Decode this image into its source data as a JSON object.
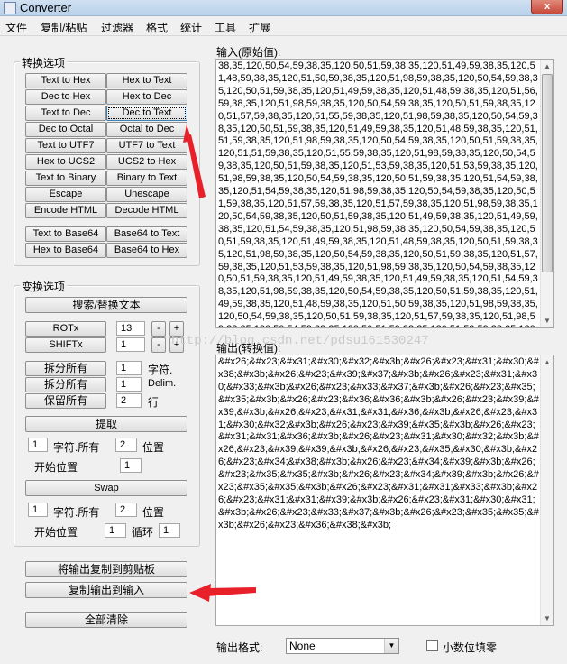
{
  "window": {
    "title": "Converter",
    "close_glyph": "x"
  },
  "menu": [
    "文件",
    "复制/粘贴",
    "过滤器",
    "格式",
    "统计",
    "工具",
    "扩展"
  ],
  "convert_group": {
    "legend": "转换选项",
    "buttons": [
      [
        "Text to Hex",
        "Hex to Text"
      ],
      [
        "Dec to Hex",
        "Hex to Dec"
      ],
      [
        "Text to Dec",
        "Dec to Text"
      ],
      [
        "Dec to Octal",
        "Octal to Dec"
      ],
      [
        "Text to UTF7",
        "UTF7 to Text"
      ],
      [
        "Hex to UCS2",
        "UCS2 to Hex"
      ],
      [
        "Text to Binary",
        "Binary to Text"
      ],
      [
        "Escape",
        "Unescape"
      ],
      [
        "Encode HTML",
        "Decode HTML"
      ],
      [
        "Text to Base64",
        "Base64 to Text"
      ],
      [
        "Hex to Base64",
        "Base64 to Hex"
      ]
    ]
  },
  "transform_group": {
    "legend": "变换选项",
    "search_replace": "搜索/替换文本",
    "rotx": {
      "label": "ROTx",
      "value": "13",
      "minus": "-",
      "plus": "+"
    },
    "shiftx": {
      "label": "SHIFTx",
      "value": "1",
      "minus": "-",
      "plus": "+"
    },
    "split_all_1": {
      "label": "拆分所有",
      "value": "1",
      "suffix": "字符."
    },
    "split_all_2": {
      "label": "拆分所有",
      "value": "1",
      "suffix": "Delim."
    },
    "keep_all": {
      "label": "保留所有",
      "value": "2",
      "suffix": "行"
    },
    "extract": {
      "label": "提取",
      "count": "1",
      "count_label": "字符.所有",
      "pos": "2",
      "pos_label": "位置",
      "start_label": "开始位置",
      "start": "1"
    },
    "swap": {
      "label": "Swap",
      "count": "1",
      "count_label": "字符.所有",
      "pos": "2",
      "pos_label": "位置",
      "start_label": "开始位置",
      "start": "1",
      "loop_label": "循环",
      "loop": "1"
    }
  },
  "actions": {
    "copy_clipboard": "将输出复制到剪贴板",
    "copy_to_input": "复制输出到输入",
    "clear_all": "全部清除"
  },
  "input": {
    "label": "输入(原始值):",
    "text": "38,35,120,50,54,59,38,35,120,50,51,59,38,35,120,51,49,59,38,35,120,51,48,59,38,35,120,51,50,59,38,35,120,51,98,59,38,35,120,50,54,59,38,35,120,50,51,59,38,35,120,51,49,59,38,35,120,51,48,59,38,35,120,51,56,59,38,35,120,51,98,59,38,35,120,50,54,59,38,35,120,50,51,59,38,35,120,51,57,59,38,35,120,51,55,59,38,35,120,51,98,59,38,35,120,50,54,59,38,35,120,50,51,59,38,35,120,51,49,59,38,35,120,51,48,59,38,35,120,51,51,59,38,35,120,51,98,59,38,35,120,50,54,59,38,35,120,50,51,59,38,35,120,51,51,59,38,35,120,51,55,59,38,35,120,51,98,59,38,35,120,50,54,59,38,35,120,50,51,59,38,35,120,51,53,59,38,35,120,51,53,59,38,35,120,51,98,59,38,35,120,50,54,59,38,35,120,50,51,59,38,35,120,51,54,59,38,35,120,51,54,59,38,35,120,51,98,59,38,35,120,50,54,59,38,35,120,50,51,59,38,35,120,51,57,59,38,35,120,51,57,59,38,35,120,51,98,59,38,35,120,50,54,59,38,35,120,50,51,59,38,35,120,51,49,59,38,35,120,51,49,59,38,35,120,51,54,59,38,35,120,51,98,59,38,35,120,50,54,59,38,35,120,50,51,59,38,35,120,51,49,59,38,35,120,51,48,59,38,35,120,50,51,59,38,35,120,51,98,59,38,35,120,50,54,59,38,35,120,50,51,59,38,35,120,51,57,59,38,35,120,51,53,59,38,35,120,51,98,59,38,35,120,50,54,59,38,35,120,50,51,59,38,35,120,51,49,59,38,35,120,51,49,59,38,35,120,51,54,59,38,35,120,51,98,59,38,35,120,50,54,59,38,35,120,50,51,59,38,35,120,51,49,59,38,35,120,51,48,59,38,35,120,51,50,59,38,35,120,51,98,59,38,35,120,50,54,59,38,35,120,50,51,59,38,35,120,51,57,59,38,35,120,51,98,59,38,35,120,50,54,59,38,35,120,50,51,59,38,35,120,51,53,59,38,35,120,51,48,59,38,35,120,50,54,59,38,35,120,50,51,59,38,35,120,51,53,59,38,35,120,51,48,59,3"
  },
  "output": {
    "label": "输出(转换值):",
    "text": "&#x26;&#x23;&#x31;&#x30;&#x32;&#x3b;&#x26;&#x23;&#x31;&#x30;&#x38;&#x3b;&#x26;&#x23;&#x39;&#x37;&#x3b;&#x26;&#x23;&#x31;&#x30;&#x33;&#x3b;&#x26;&#x23;&#x33;&#x37;&#x3b;&#x26;&#x23;&#x35;&#x35;&#x3b;&#x26;&#x23;&#x36;&#x36;&#x3b;&#x26;&#x23;&#x39;&#x39;&#x3b;&#x26;&#x23;&#x31;&#x31;&#x36;&#x3b;&#x26;&#x23;&#x31;&#x30;&#x32;&#x3b;&#x26;&#x23;&#x39;&#x35;&#x3b;&#x26;&#x23;&#x31;&#x31;&#x36;&#x3b;&#x26;&#x23;&#x31;&#x30;&#x32;&#x3b;&#x26;&#x23;&#x39;&#x39;&#x3b;&#x26;&#x23;&#x35;&#x30;&#x3b;&#x26;&#x23;&#x34;&#x38;&#x3b;&#x26;&#x23;&#x34;&#x39;&#x3b;&#x26;&#x23;&#x35;&#x35;&#x3b;&#x26;&#x23;&#x34;&#x39;&#x3b;&#x26;&#x23;&#x35;&#x35;&#x3b;&#x26;&#x23;&#x31;&#x31;&#x33;&#x3b;&#x26;&#x23;&#x31;&#x31;&#x39;&#x3b;&#x26;&#x23;&#x31;&#x30;&#x31;&#x3b;&#x26;&#x23;&#x33;&#x37;&#x3b;&#x26;&#x23;&#x35;&#x35;&#x3b;&#x26;&#x23;&#x36;&#x38;&#x3b;"
  },
  "watermark": "http://blog.csdn.net/pdsu161530247",
  "footer": {
    "format_label": "输出格式:",
    "format_value": "None",
    "decimal_pad_label": "小数位填零"
  },
  "colors": {
    "annotation_arrow": "#e8202a",
    "window_close": "#c7483a"
  }
}
